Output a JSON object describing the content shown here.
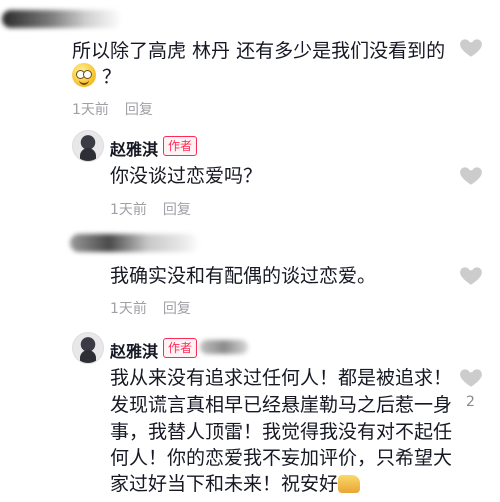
{
  "comments": [
    {
      "text_line1": "所以除了高虎 林丹 还有多少是我们没看到的",
      "text_line2": "？",
      "time": "1天前",
      "reply_label": "回复"
    }
  ],
  "replies": [
    {
      "username": "赵雅淇",
      "badge": "作者",
      "text": "你没谈过恋爱吗？",
      "time": "1天前",
      "reply_label": "回复"
    },
    {
      "text": "我确实没和有配偶的谈过恋爱。",
      "time": "1天前",
      "reply_label": "回复"
    },
    {
      "username": "赵雅淇",
      "badge": "作者",
      "lines": [
        "我从来没有追求过任何人！都是被追求！",
        "发现谎言真相早已经悬崖勒马之后惹一身",
        "事，我替人顶雷！我觉得我没有对不起任",
        "何人！你的恋爱我不妄加评价，只希望大",
        "家过好当下和未来！祝安好"
      ],
      "like_count": "2"
    }
  ],
  "colors": {
    "text": "#161823",
    "meta": "#a0a0a6",
    "badge": "#fe2c55",
    "heart": "#cccccc"
  }
}
